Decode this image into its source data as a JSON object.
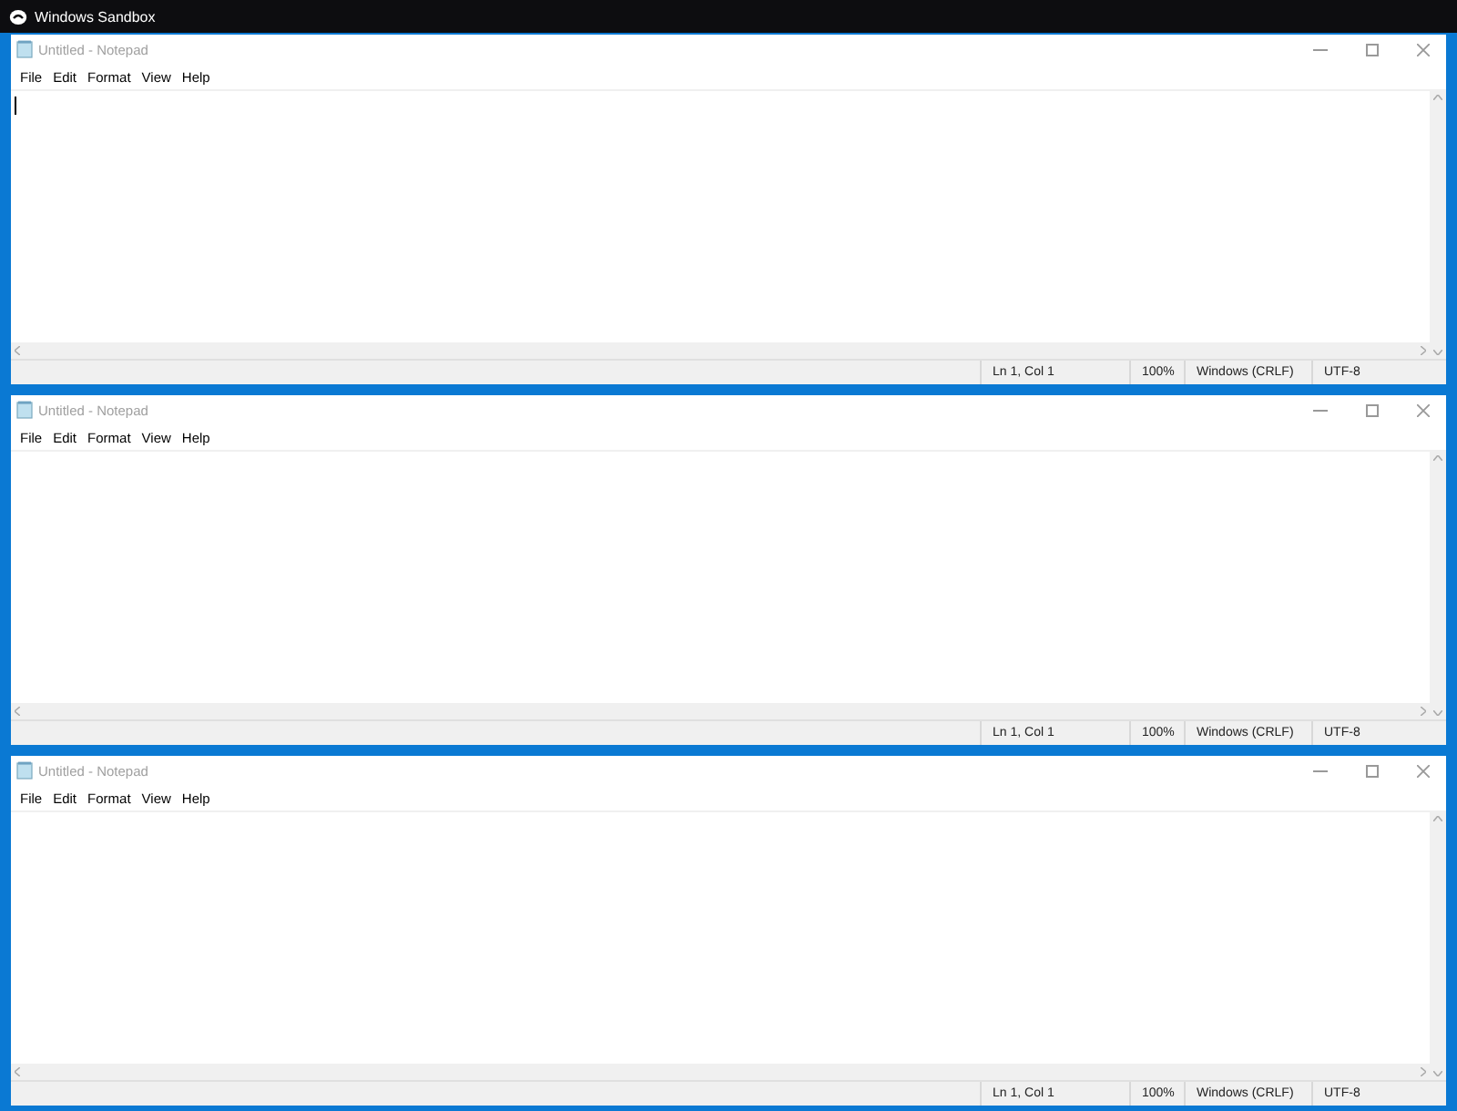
{
  "host_window": {
    "title": "Windows Sandbox"
  },
  "notepads": [
    {
      "title": "Untitled - Notepad",
      "menu": [
        "File",
        "Edit",
        "Format",
        "View",
        "Help"
      ],
      "caret": true,
      "status": [
        "Ln 1, Col 1",
        "100%",
        "Windows (CRLF)",
        "UTF-8"
      ]
    },
    {
      "title": "Untitled - Notepad",
      "menu": [
        "File",
        "Edit",
        "Format",
        "View",
        "Help"
      ],
      "caret": false,
      "status": [
        "Ln 1, Col 1",
        "100%",
        "Windows (CRLF)",
        "UTF-8"
      ]
    },
    {
      "title": "Untitled - Notepad",
      "menu": [
        "File",
        "Edit",
        "Format",
        "View",
        "Help"
      ],
      "caret": false,
      "status": [
        "Ln 1, Col 1",
        "100%",
        "Windows (CRLF)",
        "UTF-8"
      ]
    }
  ]
}
